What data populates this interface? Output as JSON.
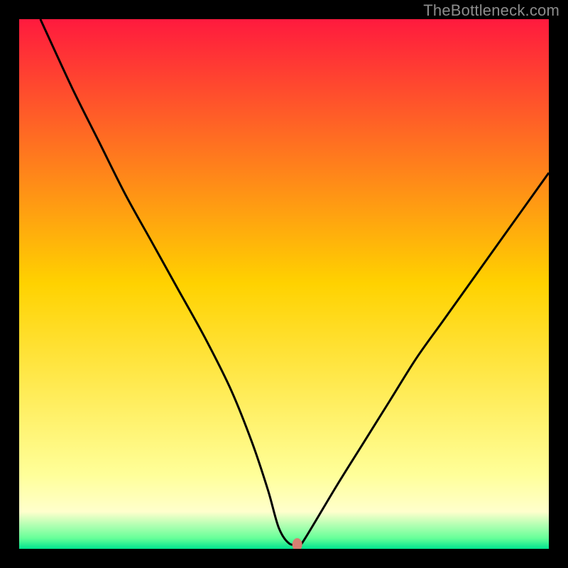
{
  "watermark": "TheBottleneck.com",
  "chart_data": {
    "type": "line",
    "title": "",
    "xlabel": "",
    "ylabel": "",
    "xlim": [
      0,
      100
    ],
    "ylim": [
      0,
      100
    ],
    "grid": false,
    "legend": false,
    "gradient_stops": [
      {
        "offset": 0,
        "color": "#ff1a3e"
      },
      {
        "offset": 50,
        "color": "#ffd200"
      },
      {
        "offset": 86,
        "color": "#ffff99"
      },
      {
        "offset": 93,
        "color": "#ffffcc"
      },
      {
        "offset": 98,
        "color": "#66ff99"
      },
      {
        "offset": 100,
        "color": "#00e38f"
      }
    ],
    "series": [
      {
        "name": "bottleneck-curve",
        "x": [
          4,
          10,
          15,
          20,
          25,
          30,
          35,
          40,
          44,
          47,
          49,
          51,
          53,
          54,
          60,
          65,
          70,
          75,
          80,
          85,
          90,
          95,
          100
        ],
        "y": [
          100,
          87,
          77,
          67,
          58,
          49,
          40,
          30,
          20,
          11,
          4,
          1,
          1,
          2,
          12,
          20,
          28,
          36,
          43,
          50,
          57,
          64,
          71
        ]
      }
    ],
    "marker": {
      "x": 52.5,
      "y": 0.8,
      "color": "#d57f72",
      "rx": 7,
      "ry": 9
    }
  }
}
